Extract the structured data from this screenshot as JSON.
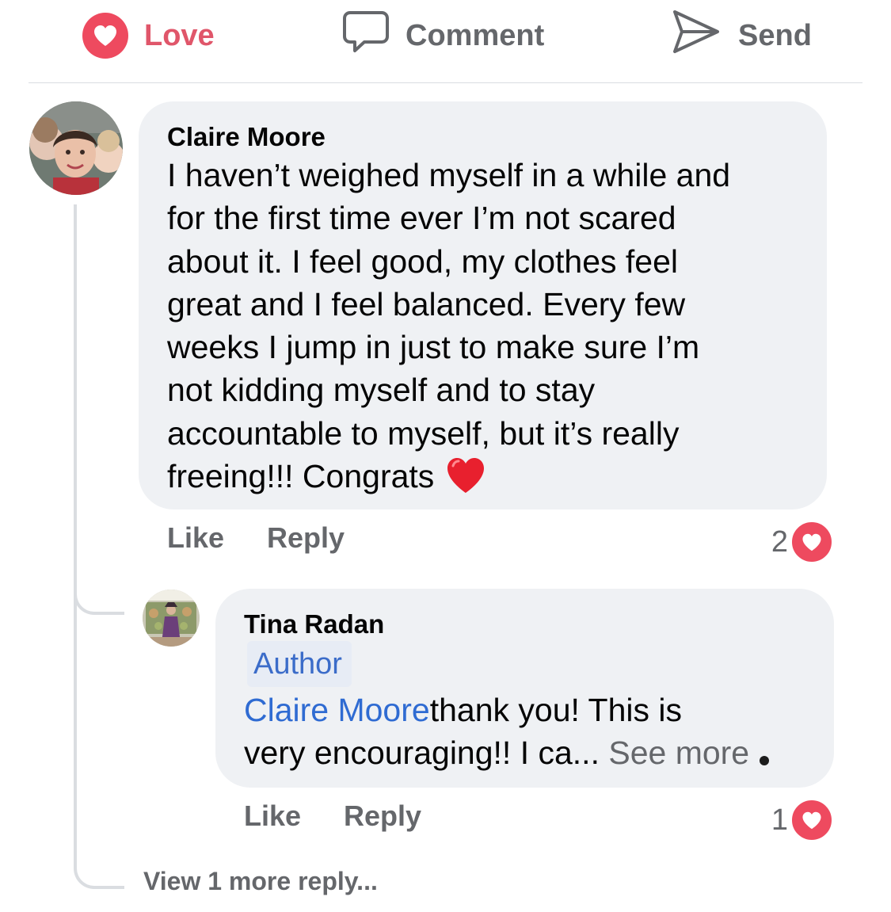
{
  "actions": {
    "love_label": "Love",
    "comment_label": "Comment",
    "send_label": "Send"
  },
  "comments": [
    {
      "author": "Claire Moore",
      "text": "I haven’t weighed myself in a while and\nfor the first time ever I’m not scared\nabout it. I feel good, my clothes feel\ngreat and I feel balanced.  Every few\nweeks I jump in just to make sure I’m\nnot kidding myself and to stay\naccountable to myself, but it’s really\nfreeing!!! Congrats",
      "like_label": "Like",
      "reply_label": "Reply",
      "reaction_count": "2",
      "reaction_color": "#ee4a5f"
    },
    {
      "author": "Tina Radan",
      "badge": "Author",
      "mention": "Claire Moore",
      "text_line1": "thank you! This is",
      "text_line2": "very encouraging!! I ca... ",
      "see_more": "See more",
      "like_label": "Like",
      "reply_label": "Reply",
      "reaction_count": "1",
      "reaction_color": "#ee4a5f"
    }
  ],
  "view_more_replies": "View 1 more reply...",
  "colors": {
    "love_red": "#ee4a5f",
    "link_blue": "#2f6bd2",
    "muted_gray": "#65676b",
    "bubble_bg": "#eff1f4"
  },
  "icons": {
    "love": "heart-icon",
    "comment": "speech-bubble-icon",
    "send": "paper-plane-icon",
    "emoji": "red-heart-emoji"
  }
}
